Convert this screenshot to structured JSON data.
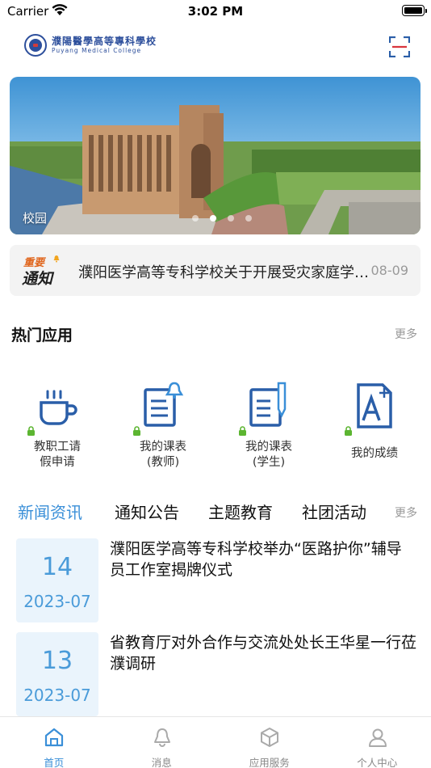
{
  "status_bar": {
    "carrier": "Carrier",
    "time": "3:02 PM"
  },
  "header": {
    "logo_cn": "濮陽醫學高等專科學校",
    "logo_en": "Puyang Medical College",
    "scan_icon": "scan-icon"
  },
  "banner": {
    "caption": "校园",
    "dots": 4,
    "active_dot": 2
  },
  "notice": {
    "badge_top": "重要",
    "badge_bottom": "通知",
    "text": "濮阳医学高等专科学校关于开展受灾家庭学生资助工作的通知",
    "date": "08-09"
  },
  "hot_apps": {
    "title": "热门应用",
    "more": "更多",
    "items": [
      {
        "label_line1": "教职工请",
        "label_line2": "假申请",
        "icon": "coffee-cup-icon",
        "locked": true
      },
      {
        "label_line1": "我的课表",
        "label_line2": "(教师)",
        "icon": "schedule-bell-icon",
        "locked": true
      },
      {
        "label_line1": "我的课表",
        "label_line2": "(学生)",
        "icon": "schedule-pen-icon",
        "locked": true
      },
      {
        "label_line1": "我的成绩",
        "label_line2": "",
        "icon": "grade-a-plus-icon",
        "locked": true
      }
    ]
  },
  "news_tabs": {
    "tabs": [
      "新闻资讯",
      "通知公告",
      "主题教育",
      "社团活动"
    ],
    "active": 0,
    "more": "更多"
  },
  "news": [
    {
      "day": "14",
      "month": "2023-07",
      "title": "濮阳医学高等专科学校举办“医路护你”辅导员工作室揭牌仪式"
    },
    {
      "day": "13",
      "month": "2023-07",
      "title": "省教育厅对外合作与交流处处长王华星一行莅濮调研"
    }
  ],
  "tabbar": {
    "items": [
      {
        "label": "首页",
        "icon": "home-icon",
        "active": true
      },
      {
        "label": "消息",
        "icon": "bell-icon",
        "active": false
      },
      {
        "label": "应用服务",
        "icon": "cube-icon",
        "active": false
      },
      {
        "label": "个人中心",
        "icon": "person-icon",
        "active": false
      }
    ]
  },
  "colors": {
    "accent": "#3a8fd8",
    "brand": "#2d4f9c",
    "lock": "#5cb531",
    "icon_blue": "#2a5ea8"
  }
}
